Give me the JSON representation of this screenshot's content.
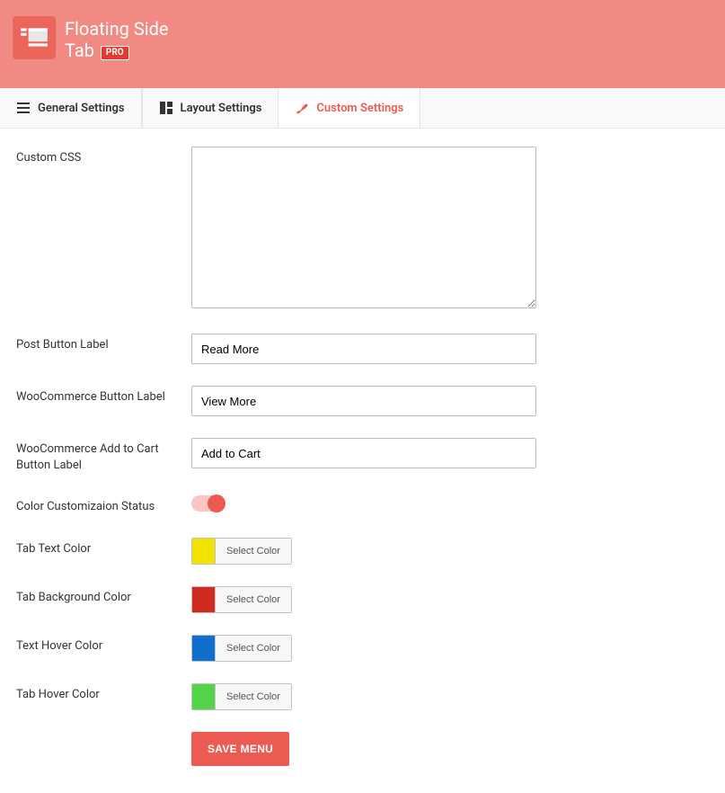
{
  "header": {
    "title_line1": "Floating Side",
    "title_line2": "Tab",
    "badge": "PRO"
  },
  "tabs": [
    {
      "label": "General Settings",
      "icon": "menu-icon"
    },
    {
      "label": "Layout Settings",
      "icon": "layout-icon"
    },
    {
      "label": "Custom Settings",
      "icon": "brush-icon"
    }
  ],
  "active_tab_index": 2,
  "form": {
    "custom_css": {
      "label": "Custom CSS",
      "value": ""
    },
    "post_button": {
      "label": "Post Button Label",
      "value": "Read More"
    },
    "woo_button": {
      "label": "WooCommerce Button Label",
      "value": "View More"
    },
    "woo_cart_button": {
      "label": "WooCommerce Add to Cart Button Label",
      "value": "Add to Cart"
    },
    "color_status": {
      "label": "Color Customizaion Status",
      "on": true
    },
    "tab_text_color": {
      "label": "Tab Text Color",
      "color": "#f2e200",
      "btn": "Select Color"
    },
    "tab_bg_color": {
      "label": "Tab Background Color",
      "color": "#d02b1f",
      "btn": "Select Color"
    },
    "text_hover_color": {
      "label": "Text Hover Color",
      "color": "#106fcc",
      "btn": "Select Color"
    },
    "tab_hover_color": {
      "label": "Tab Hover Color",
      "color": "#53d44a",
      "btn": "Select Color"
    }
  },
  "save_button": "SAVE MENU",
  "colors": {
    "accent": "#ec5b51",
    "header_bg": "#f08a83"
  }
}
